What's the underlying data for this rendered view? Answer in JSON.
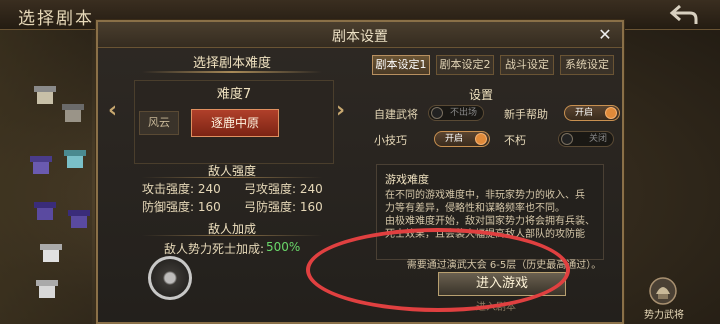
{
  "topbar": {
    "title": "选择剧本"
  },
  "modal": {
    "title": "剧本设置",
    "close": "✕",
    "left": {
      "title": "选择剧本难度",
      "difficulty_level": "难度7",
      "prev_option": "风云",
      "selected_option": "逐鹿中原",
      "enemy_strength": {
        "heading": "敌人强度",
        "attack": "攻击强度: 240",
        "bow_attack": "弓攻强度: 240",
        "defense": "防御强度: 160",
        "bow_defense": "弓防强度: 160"
      },
      "enemy_bonus": {
        "heading": "敌人加成",
        "label": "敌人势力死士加成:",
        "value": "500%"
      }
    },
    "tabs": [
      {
        "label": "剧本设定1",
        "active": true
      },
      {
        "label": "剧本设定2",
        "active": false
      },
      {
        "label": "战斗设定",
        "active": false
      },
      {
        "label": "系统设定",
        "active": false
      }
    ],
    "settings": {
      "heading": "设置",
      "items": [
        {
          "label": "自建武将",
          "state": "不出场",
          "on": false
        },
        {
          "label": "新手帮助",
          "state": "开启",
          "on": true
        },
        {
          "label": "小技巧",
          "state": "开启",
          "on": true
        },
        {
          "label": "不朽",
          "state": "关闭",
          "on": false
        }
      ]
    },
    "description": {
      "title": "游戏难度",
      "lines": [
        "在不同的游戏难度中，非玩家势力的收入、兵",
        "力等有差异，侵略性和谋略频率也不同。",
        "由极难难度开始，敌对国家势力将会拥有兵装、",
        "死士效果，且会装大幅提高敌人部队的攻防能"
      ]
    },
    "note": "需要通过演武大会 6-5层（历史最高通过）。",
    "enter_button": "进入游戏",
    "below_text": "进入剧本"
  },
  "power_general": {
    "label": "势力武将"
  },
  "colors": {
    "accent_red": "#b0402a",
    "toggle_on": "#e08a3a",
    "green_value": "#6ad86a",
    "annotation": "#e04040"
  }
}
